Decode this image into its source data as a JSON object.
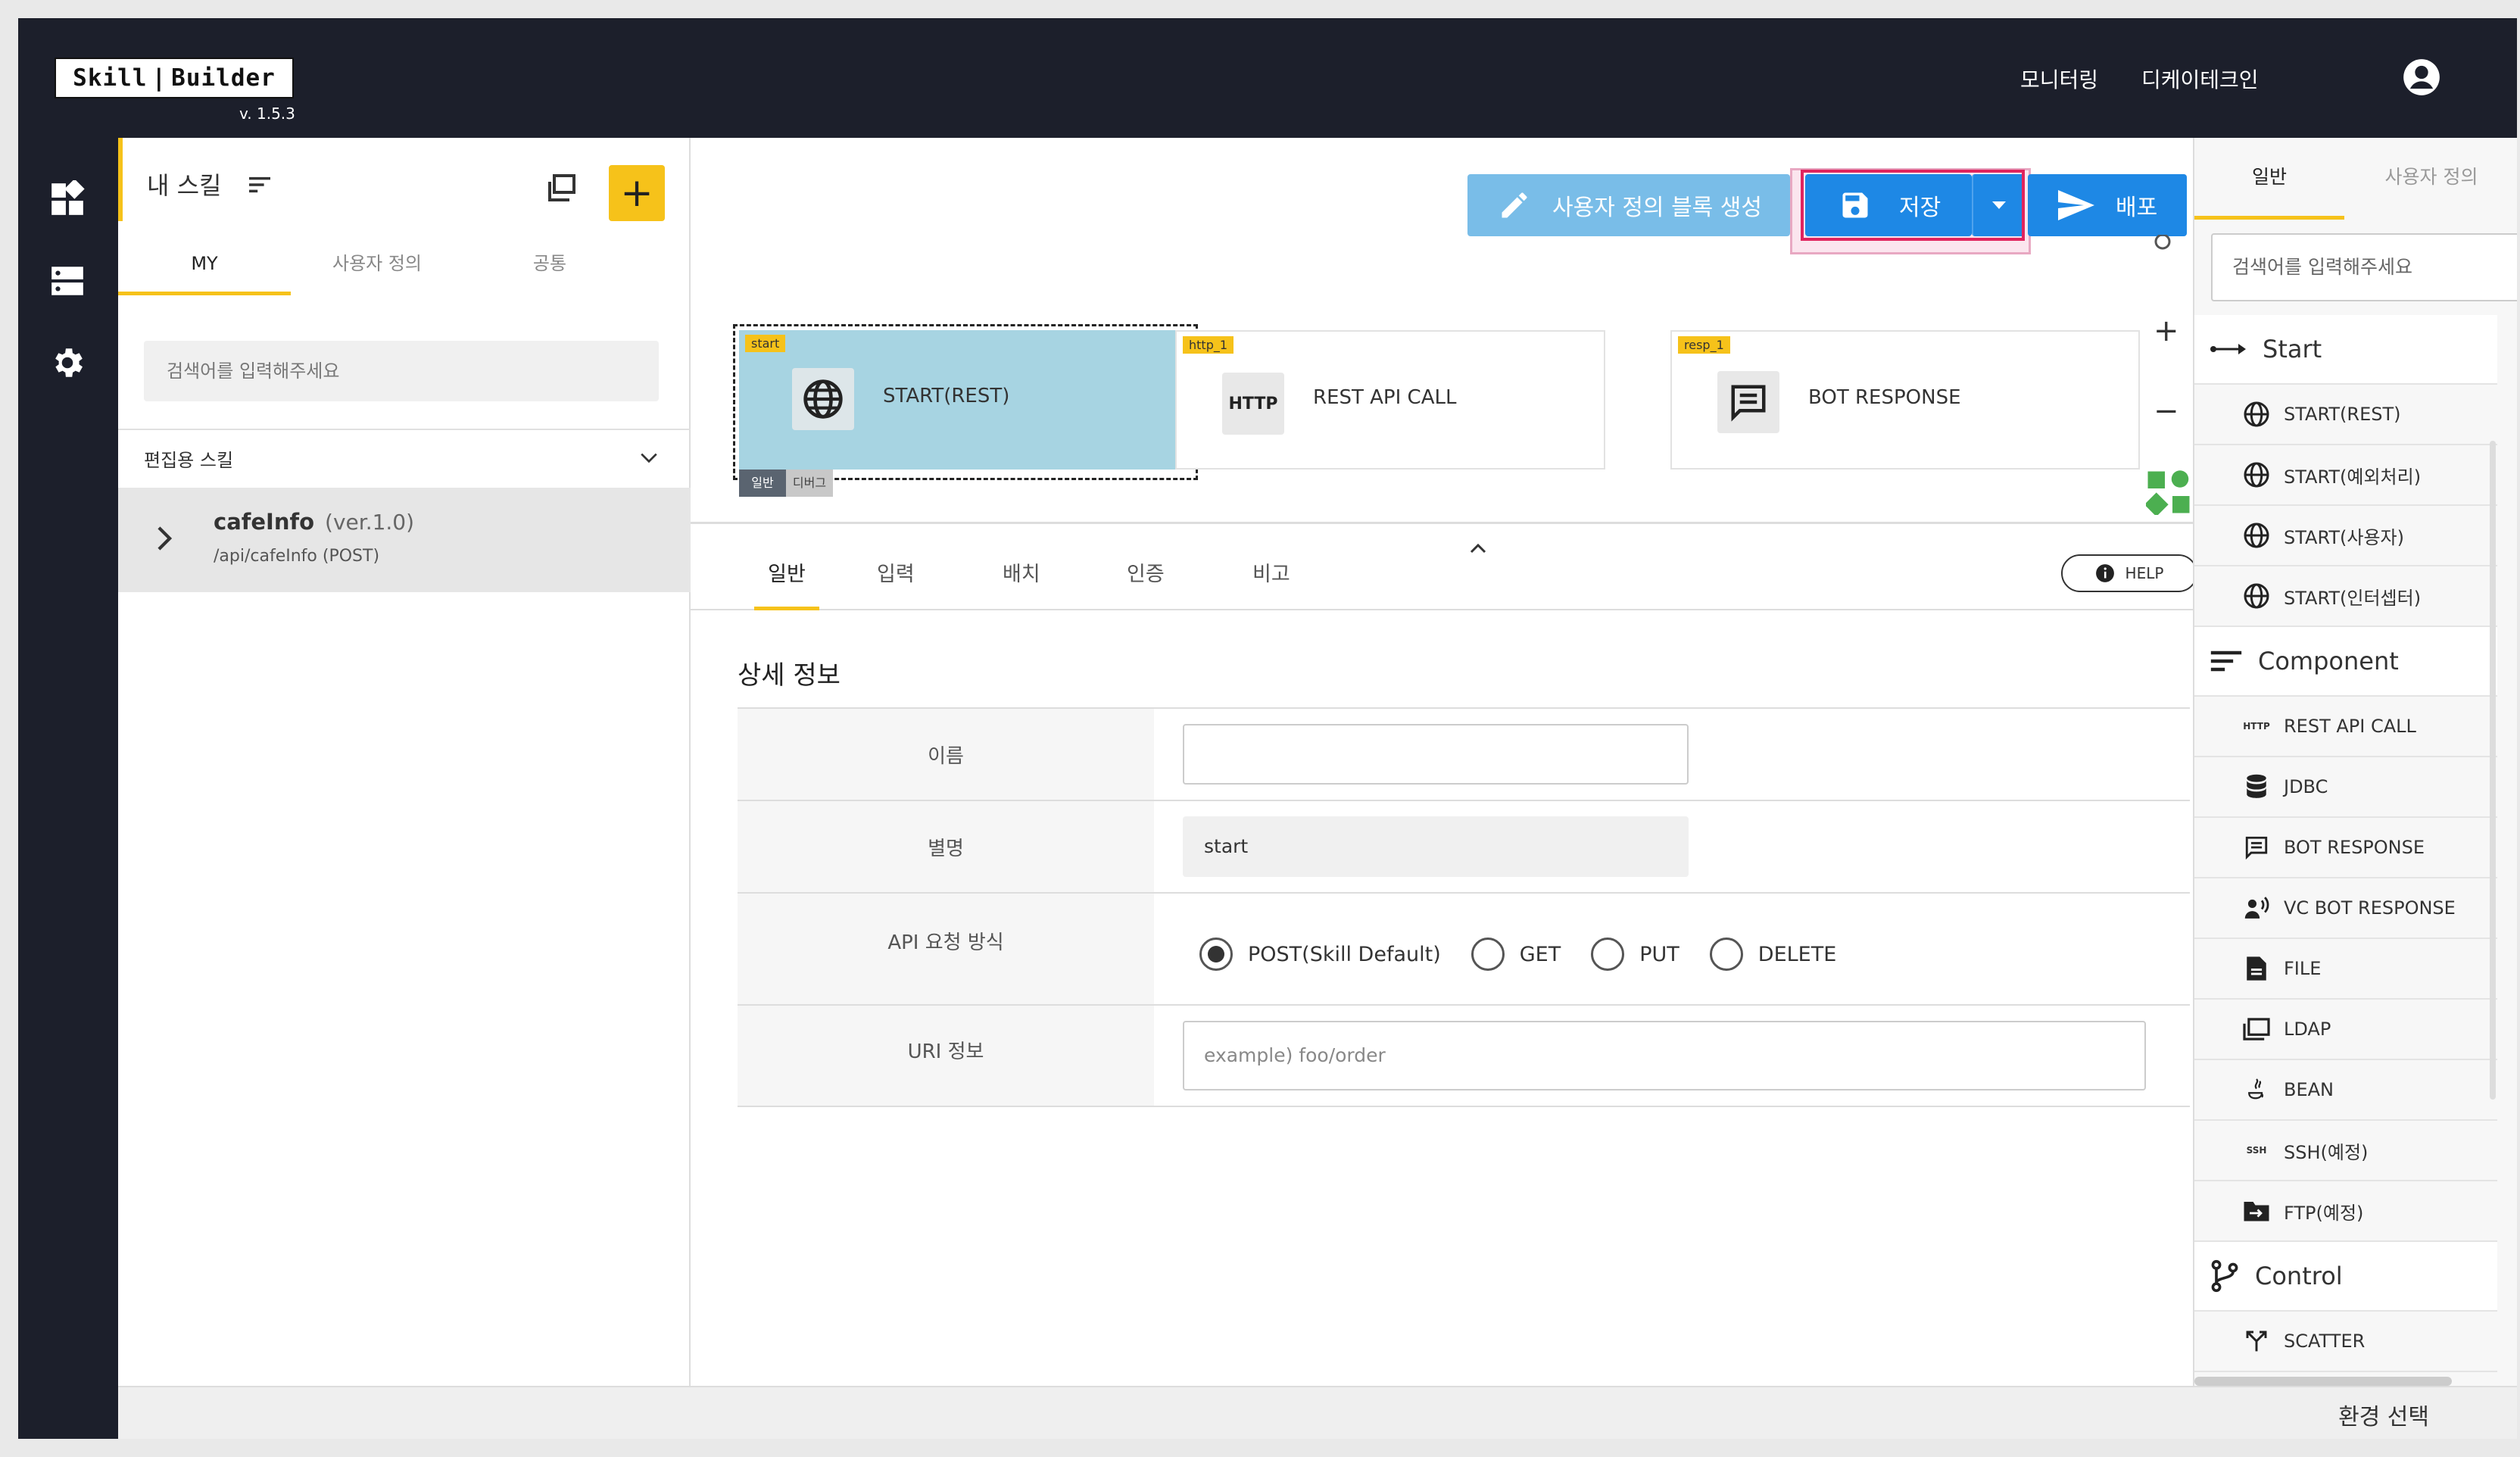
{
  "app": {
    "logo_left": "Skill",
    "logo_right": "Builder",
    "version": "v. 1.5.3"
  },
  "topnav": {
    "monitoring": "모니터링",
    "company": "디케이테크인"
  },
  "panel": {
    "title": "내 스킬",
    "tabs": [
      {
        "label": "MY"
      },
      {
        "label": "사용자 정의"
      },
      {
        "label": "공통"
      }
    ],
    "search_placeholder": "검색어를 입력해주세요",
    "section": "편집용 스킬",
    "skill": {
      "name": "cafeInfo",
      "version": "(ver.1.0)",
      "path": "/api/cafeInfo (POST)"
    }
  },
  "toolbar": {
    "custom_block": "사용자 정의 블록 생성",
    "save": "저장",
    "deploy": "배포"
  },
  "canvas": {
    "nodes": [
      {
        "tag": "start",
        "label": "START(REST)"
      },
      {
        "tag": "http_1",
        "label": "REST API CALL",
        "icon_text": "HTTP"
      },
      {
        "tag": "resp_1",
        "label": "BOT RESPONSE"
      }
    ],
    "node_tabs": [
      "일반",
      "디버그"
    ]
  },
  "detail": {
    "tabs": [
      {
        "label": "일반"
      },
      {
        "label": "입력"
      },
      {
        "label": "배치"
      },
      {
        "label": "인증"
      },
      {
        "label": "비고"
      }
    ],
    "help": "HELP",
    "title": "상세 정보",
    "rows": {
      "name_label": "이름",
      "name_value": "",
      "alias_label": "별명",
      "alias_value": "start",
      "method_label": "API 요청 방식",
      "methods": [
        "POST(Skill Default)",
        "GET",
        "PUT",
        "DELETE"
      ],
      "selected_method": "POST(Skill Default)",
      "uri_label": "URI 정보",
      "uri_placeholder": "example) foo/order"
    }
  },
  "palette": {
    "tabs": [
      {
        "label": "일반"
      },
      {
        "label": "사용자 정의"
      }
    ],
    "search_placeholder": "검색어를 입력해주세요",
    "start_title": "Start",
    "start_items": [
      "START(REST)",
      "START(예외처리)",
      "START(사용자)",
      "START(인터셉터)"
    ],
    "component_title": "Component",
    "component_items": [
      "REST API CALL",
      "JDBC",
      "BOT RESPONSE",
      "VC BOT RESPONSE",
      "FILE",
      "LDAP",
      "BEAN",
      "SSH(예정)",
      "FTP(예정)"
    ],
    "control_title": "Control",
    "control_items": [
      "SCATTER"
    ]
  },
  "footer": {
    "env_select": "환경 선택"
  }
}
